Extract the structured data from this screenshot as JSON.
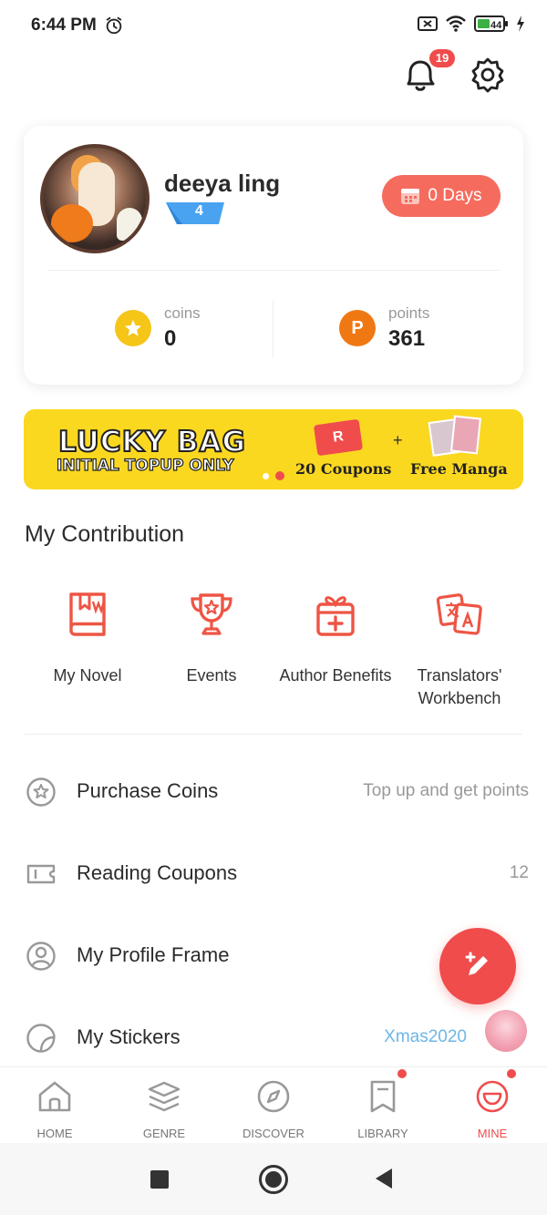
{
  "status_bar": {
    "time": "6:44 PM",
    "battery": "44"
  },
  "header": {
    "notification_count": "19"
  },
  "profile": {
    "username": "deeya ling",
    "level": "4",
    "checkin_label": "0 Days",
    "coins_label": "coins",
    "coins_value": "0",
    "points_label": "points",
    "points_value": "361"
  },
  "banner": {
    "title": "LUCKY BAG",
    "subtitle": "INITIAL TOPUP ONLY",
    "coupon_letter": "R",
    "plus": "+",
    "coupons_label": "20 Coupons",
    "manga_label": "Free Manga"
  },
  "contribution": {
    "title": "My Contribution",
    "items": [
      {
        "label": "My Novel"
      },
      {
        "label": "Events"
      },
      {
        "label": "Author Benefits"
      },
      {
        "label": "Translators' Workbench"
      }
    ]
  },
  "menu": {
    "purchase_coins": {
      "label": "Purchase Coins",
      "right": "Top up and get points"
    },
    "reading_coupons": {
      "label": "Reading Coupons",
      "right": "12"
    },
    "profile_frame": {
      "label": "My Profile Frame"
    },
    "stickers": {
      "label": "My Stickers",
      "right": "Xmas2020"
    }
  },
  "bottom_nav": {
    "items": [
      {
        "label": "HOME"
      },
      {
        "label": "GENRE"
      },
      {
        "label": "DISCOVER"
      },
      {
        "label": "LIBRARY"
      },
      {
        "label": "MINE"
      }
    ]
  },
  "colors": {
    "accent": "#f04c4c",
    "banner_yellow": "#fbd820",
    "checkin_button": "#f56c5e",
    "coin_gold": "#f5c518",
    "points_orange": "#f07812",
    "sticker_link": "#6db6e6"
  },
  "icons": [
    "alarm-icon",
    "mute-icon",
    "wifi-icon",
    "battery-icon",
    "charging-icon",
    "bell-icon",
    "gear-icon",
    "calendar-icon",
    "star-coin-icon",
    "points-icon",
    "book-icon",
    "trophy-icon",
    "gift-icon",
    "translate-icon",
    "star-badge-icon",
    "ticket-icon",
    "profile-frame-icon",
    "sticker-icon",
    "pencil-icon",
    "home-icon",
    "layers-icon",
    "compass-icon",
    "bookmark-icon",
    "mine-icon"
  ]
}
